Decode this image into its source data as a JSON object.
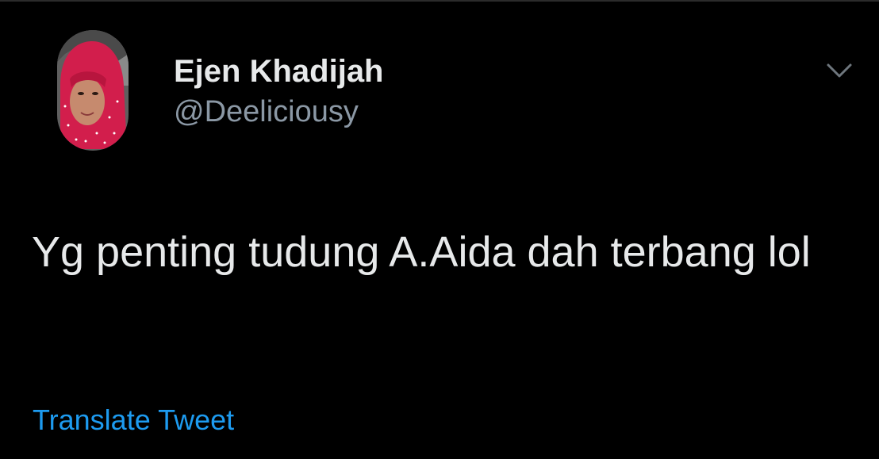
{
  "tweet": {
    "author": {
      "display_name": "Ejen Khadijah",
      "handle": "@Deeliciousy"
    },
    "text": "Yg penting tudung A.Aida dah terbang lol",
    "translate_label": "Translate Tweet"
  },
  "icons": {
    "menu": "chevron-down-icon",
    "avatar": "profile-photo"
  },
  "colors": {
    "background": "#000000",
    "primary_text": "#e7e9ea",
    "secondary_text": "#8b98a5",
    "link": "#1d9bf0"
  }
}
